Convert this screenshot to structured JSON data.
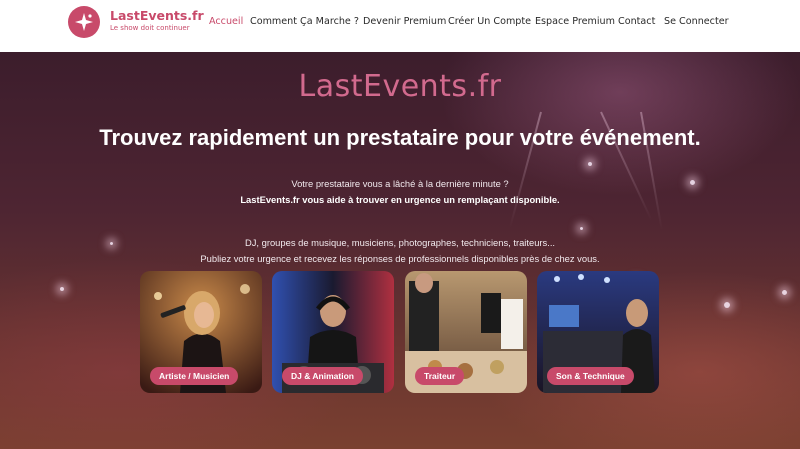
{
  "header": {
    "logo_title": "LastEvents.fr",
    "logo_tagline": "Le show doit continuer",
    "nav": [
      {
        "label": "Accueil",
        "active": true
      },
      {
        "label": "Comment Ça Marche ?",
        "active": false
      },
      {
        "label": "Devenir Premium",
        "active": false
      },
      {
        "label": "Créer Un Compte",
        "active": false
      },
      {
        "label": "Espace Premium",
        "active": false
      },
      {
        "label": "Contact",
        "active": false
      },
      {
        "label": "Se Connecter",
        "active": false
      }
    ]
  },
  "hero": {
    "brand": "LastEvents.fr",
    "headline": "Trouvez rapidement un prestataire pour votre événement.",
    "line1": "Votre prestataire vous a lâché à la dernière minute ?",
    "line2": "LastEvents.fr vous aide à trouver en urgence un remplaçant disponible.",
    "line3": "DJ, groupes de musique, musiciens, photographes, techniciens, traiteurs...",
    "line4": "Publiez votre urgence et recevez les réponses de professionnels disponibles près de chez vous."
  },
  "categories": [
    {
      "label": "Artiste / Musicien",
      "icon": "singer-photo"
    },
    {
      "label": "DJ & Animation",
      "icon": "dj-photo"
    },
    {
      "label": "Traiteur",
      "icon": "catering-photo"
    },
    {
      "label": "Son & Technique",
      "icon": "sound-desk-photo"
    }
  ],
  "colors": {
    "accent": "#c84a6a",
    "hero_dark": "#3c1d2c"
  }
}
